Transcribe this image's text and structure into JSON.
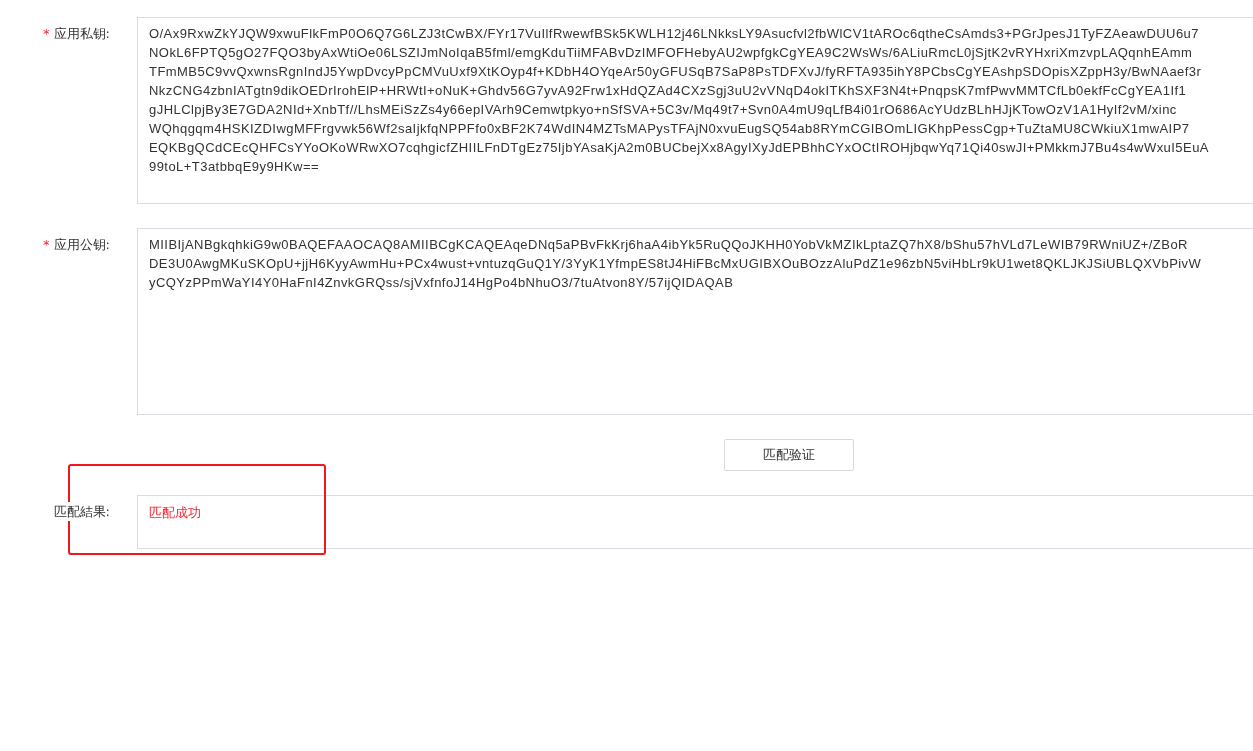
{
  "fields": [
    {
      "kind": "key",
      "label": "应用私钥:",
      "required_mark": "*",
      "lines": [
        "O/Ax9RxwZkYJQW9xwuFlkFmP0O6Q7G6LZJ3tCwBX/FYr17VuIlfRwewfBSk5KWLH12j46LNkksLY9Asucfvl2fbWlCV1tAROc6qtheCsAmds3+PGrJpesJ1TyFZAeawDUU6u7",
        "NOkL6FPTQ5gO27FQO3byAxWtiOe06LSZIJmNoIqaB5fml/emgKduTiiMFABvDzIMFOFHebyAU2wpfgkCgYEA9C2WsWs/6ALiuRmcL0jSjtK2vRYHxriXmzvpLAQqnhEAmm",
        "TFmMB5C9vvQxwnsRgnIndJ5YwpDvcyPpCMVuUxf9XtKOyp4f+KDbH4OYqeAr50yGFUSqB7SaP8PsTDFXvJ/fyRFTA935ihY8PCbsCgYEAshpSDOpisXZppH3y/BwNAaef3r",
        "NkzCNG4zbnIATgtn9dikOEDrIrohElP+HRWtI+oNuK+Ghdv56G7yvA92Frw1xHdQZAd4CXzSgj3uU2vVNqD4okITKhSXF3N4t+PnqpsK7mfPwvMMTCfLb0ekfFcCgYEA1If1",
        "gJHLClpjBy3E7GDA2NId+XnbTf//LhsMEiSzZs4y66epIVArh9Cemwtpkyo+nSfSVA+5C3v/Mq49t7+Svn0A4mU9qLfB4i01rO686AcYUdzBLhHJjKTowOzV1A1HyIf2vM/xinc",
        "WQhqgqm4HSKIZDIwgMFFrgvwk56Wf2saIjkfqNPPFfo0xBF2K74WdIN4MZTsMAPysTFAjN0xvuEugSQ54ab8RYmCGIBOmLIGKhpPessCgp+TuZtaMU8CWkiuX1mwAIP7",
        "EQKBgQCdCEcQHFCsYYoOKoWRwXO7cqhgicfZHIILFnDTgEz75IjbYAsaKjA2m0BUCbejXx8AgyIXyJdEPBhhCYxOCtIROHjbqwYq71Qi40swJI+PMkkmJ7Bu4s4wWxuI5EuA",
        "99toL+T3atbbqE9y9HKw=="
      ]
    },
    {
      "kind": "key",
      "label": "应用公钥:",
      "required_mark": "*",
      "lines": [
        "MIIBIjANBgkqhkiG9w0BAQEFAAOCAQ8AMIIBCgKCAQEAqeDNq5aPBvFkKrj6haA4ibYk5RuQQoJKHH0YobVkMZIkLptaZQ7hX8/bShu57hVLd7LeWIB79RWniUZ+/ZBoR",
        "DE3U0AwgMKuSKOpU+jjH6KyyAwmHu+PCx4wust+vntuzqGuQ1Y/3YyK1YfmpES8tJ4HiFBcMxUGIBXOuBOzzAluPdZ1e96zbN5viHbLr9kU1wet8QKLJKJSiUBLQXVbPivW",
        "yCQYzPPmWaYI4Y0HaFnI4ZnvkGRQss/sjVxfnfoJ14HgPo4bNhuO3/7tuAtvon8Y/57ijQIDAQAB"
      ]
    },
    {
      "kind": "button",
      "label": "匹配验证"
    },
    {
      "kind": "result",
      "label": "匹配結果:",
      "value": "匹配成功",
      "highlighted": true
    }
  ]
}
